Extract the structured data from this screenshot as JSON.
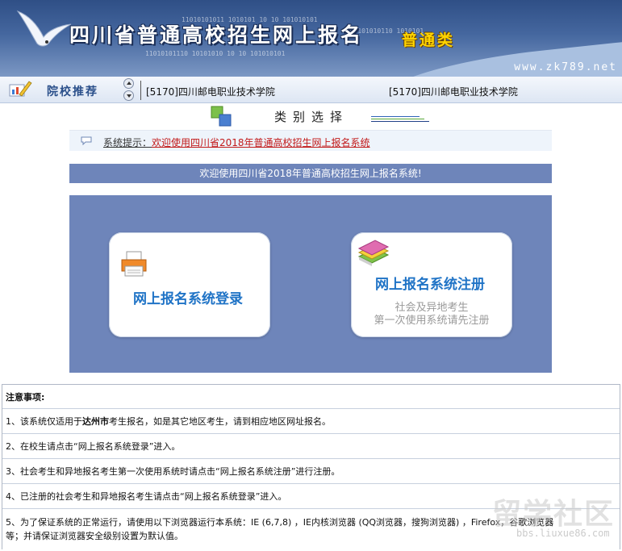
{
  "banner": {
    "title": "四川省普通高校招生网上报名",
    "subtitle": "普通类",
    "url": "www.zk789.net",
    "binary_1": "11010101011 1010101 10 10 101010101",
    "binary_2": "0101 010 101010110 1010101",
    "binary_3": "11010101110 10101010 10 10 101010101"
  },
  "recommend": {
    "label": "院校推荐",
    "school_1": "[5170]四川邮电职业技术学院",
    "school_2": "[5170]四川邮电职业技术学院"
  },
  "category": {
    "title": "类别选择",
    "line_colors": [
      "#2f63b9",
      "#58a93a",
      "#1f3f87"
    ]
  },
  "notice": {
    "label": "系统提示：",
    "text": "欢迎使用四川省2018年普通高校招生网上报名系统"
  },
  "welcome": "欢迎使用四川省2018年普通高校招生网上报名系统!",
  "cards": {
    "login_title": "网上报名系统登录",
    "register_title": "网上报名系统注册",
    "register_sub_1": "社会及异地考生",
    "register_sub_2": "第一次使用系统请先注册"
  },
  "notes": {
    "heading": "注意事项:",
    "item1_pre": "1、该系统仅适用于",
    "item1_city": "达州市",
    "item1_post": "考生报名，如是其它地区考生，请到相应地区网址报名。",
    "item2": "2、在校生请点击“网上报名系统登录”进入。",
    "item3": "3、社会考生和异地报名考生第一次使用系统时请点击“网上报名系统注册”进行注册。",
    "item4": "4、已注册的社会考生和异地报名考生请点击“网上报名系统登录”进入。",
    "item5_line1": "5、为了保证系统的正常运行，请使用以下浏览器运行本系统：IE (6,7,8) ，IE内核浏览器 (QQ浏览器，搜狗浏览器) ，Firefox，谷歌浏览器",
    "item5_line2": "等；并请保证浏览器安全级别设置为默认值。"
  },
  "watermark": {
    "big": "留学社区",
    "small": "bbs.liuxue86.com"
  },
  "colors": {
    "panel": "#6e85ba",
    "card_title": "#1f73c6",
    "notice_text": "#c21a1a"
  }
}
